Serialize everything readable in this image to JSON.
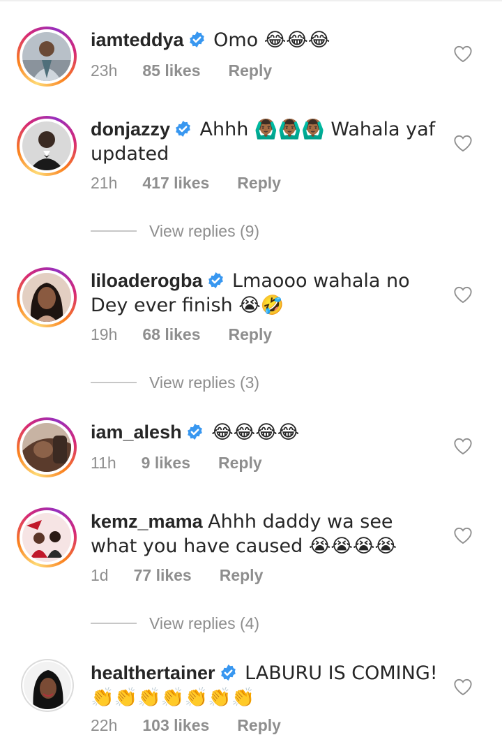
{
  "comments": [
    {
      "username": "iamteddya",
      "verified": true,
      "text": "Omo 😂😂😂",
      "time": "23h",
      "likes": "85 likes",
      "reply": "Reply",
      "story_ring": true
    },
    {
      "username": "donjazzy",
      "verified": true,
      "text": "Ahhh 🙆🏾‍♂️🙆🏾‍♂️🙆🏾‍♂️ Wahala yaf updated",
      "time": "21h",
      "likes": "417 likes",
      "reply": "Reply",
      "view_replies": "View replies (9)",
      "story_ring": true
    },
    {
      "username": "liloaderogba",
      "verified": true,
      "text": "Lmaooo wahala no Dey ever finish 😭🤣",
      "time": "19h",
      "likes": "68 likes",
      "reply": "Reply",
      "view_replies": "View replies (3)",
      "story_ring": true
    },
    {
      "username": "iam_alesh",
      "verified": true,
      "text": "😂😂😂😂",
      "time": "11h",
      "likes": "9 likes",
      "reply": "Reply",
      "story_ring": true
    },
    {
      "username": "kemz_mama",
      "verified": false,
      "text": "Ahhh daddy wa see what you have caused 😭😭😭😭",
      "time": "1d",
      "likes": "77 likes",
      "reply": "Reply",
      "view_replies": "View replies (4)",
      "story_ring": true
    },
    {
      "username": "healthertainer",
      "verified": true,
      "text": "LABURU IS COMING! 👏👏👏👏👏👏👏",
      "time": "22h",
      "likes": "103 likes",
      "reply": "Reply",
      "story_ring": false
    }
  ],
  "colors": {
    "text": "#262626",
    "meta": "#8e8e8e",
    "verified": "#3897f0",
    "divider": "#c7c7c7"
  },
  "icons": {
    "verified": "verified-badge-icon",
    "like": "heart-outline-icon"
  }
}
